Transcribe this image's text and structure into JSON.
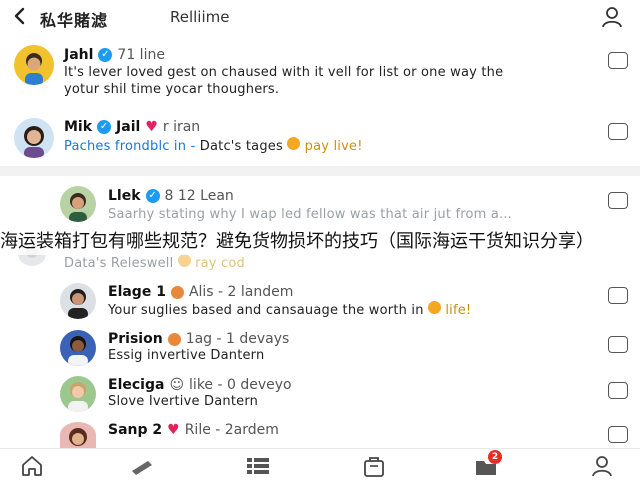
{
  "header": {
    "title": "私华賭滤",
    "tab": "Relliime"
  },
  "posts": [
    {
      "name": "Jahl",
      "meta": "71 line",
      "line1": "It's lever loved gest on chaused with it vell for list or one way the",
      "line2": "yotur shil time yocar thoughers."
    },
    {
      "name": "Mik",
      "name2": "Jail",
      "meta": "r iran",
      "line_link": "Paches frondblc in -",
      "line_rest": "Datc's tages",
      "line_tail": "pay live!"
    },
    {
      "name": "Llek",
      "meta": "8 12 Lean",
      "line1": "Saarhy stating why I wap led fellow was that air jut from a...",
      "line2": "Data's Releswell",
      "line2_tail": "ray cod"
    },
    {
      "name": "Elage 1",
      "meta": "Alis - 2 landem",
      "line1": "Your suglies based and cansauage the worth in",
      "line1_tail": "life!"
    },
    {
      "name": "Prision",
      "meta": "1ag - 1 devays",
      "line1": "Essig invertive Dantern"
    },
    {
      "name": "Eleciga",
      "meta": "like - 0 deveyo",
      "line1": "Slove Ivertive Dantern"
    },
    {
      "name": "Sanp 2",
      "meta": "Rile - 2ardem"
    }
  ],
  "watermark": "海运装箱打包有哪些规范？避免货物损坏的技巧（国际海运干货知识分享）",
  "bottom_nav": {
    "notification_count": "2"
  },
  "colors": {
    "verified": "#1d9bf0",
    "link": "#1d76d2",
    "heart": "#e0245e",
    "badge": "#e52d27"
  }
}
